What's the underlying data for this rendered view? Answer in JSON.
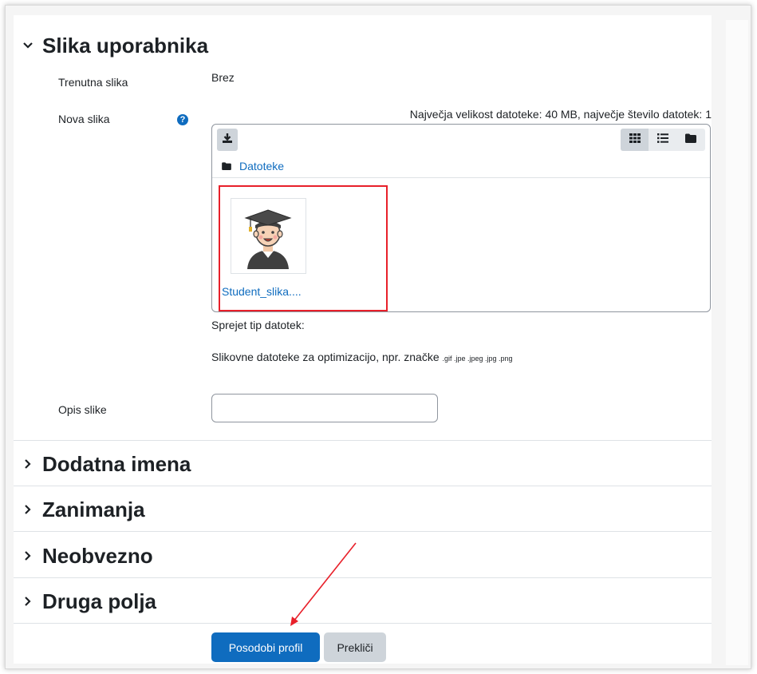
{
  "section_user_picture": {
    "title": "Slika uporabnika",
    "current_picture_label": "Trenutna slika",
    "current_picture_value": "Brez",
    "new_picture_label": "Nova slika",
    "help_symbol": "?",
    "max_info": "Največja velikost datoteke: 40 MB, največje število datotek: 1",
    "folder_label": "Datoteke",
    "file_name": "Student_slika....",
    "accepted_types_label": "Sprejet tip datotek:",
    "accepted_types_desc": "Slikovne datoteke za optimizacijo, npr. značke",
    "accepted_types_ext": ".gif .jpe .jpeg .jpg .png",
    "description_label": "Opis slike",
    "description_value": ""
  },
  "collapsed_sections": [
    "Dodatna imena",
    "Zanimanja",
    "Neobvezno",
    "Druga polja"
  ],
  "buttons": {
    "update_profile": "Posodobi profil",
    "cancel": "Prekliči"
  },
  "icons": {
    "expanded_chevron": "chevron-down-icon",
    "collapsed_chevron": "chevron-right-icon",
    "help": "question-circle-icon",
    "download": "download-icon",
    "grid_view": "grid-view-icon",
    "list_view": "list-view-icon",
    "tree_view": "folder-view-icon",
    "folder": "folder-icon"
  },
  "colors": {
    "primary": "#0f6cbf",
    "highlight": "#e8202a"
  }
}
